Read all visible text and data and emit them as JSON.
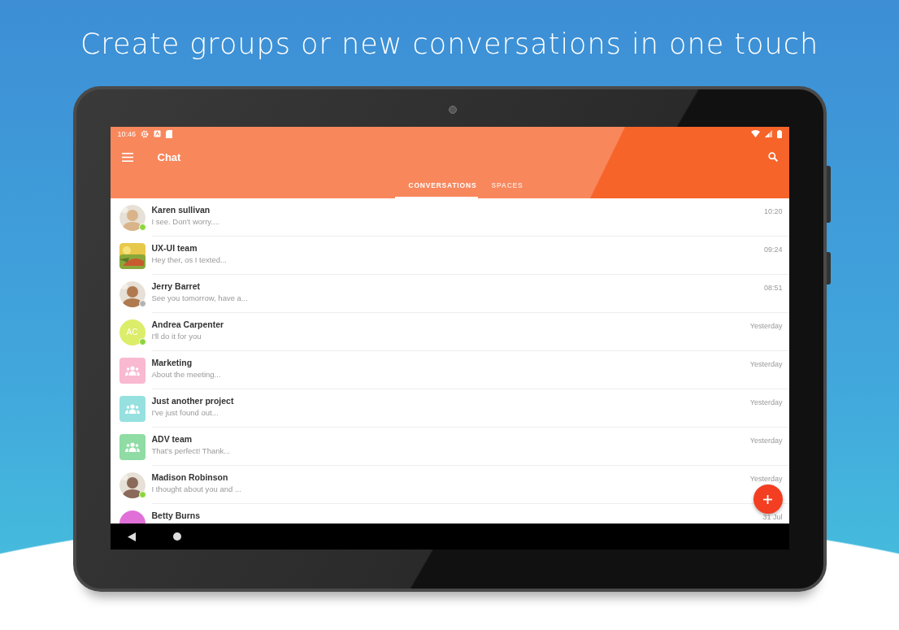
{
  "headline": "Create groups or new conversations in one touch",
  "status_bar": {
    "time": "10:46"
  },
  "toolbar": {
    "title": "Chat"
  },
  "tabs": [
    {
      "label": "CONVERSATIONS",
      "selected": true
    },
    {
      "label": "SPACES",
      "selected": false
    }
  ],
  "conversations": [
    {
      "name": "Karen sullivan",
      "preview": "I see. Don't worry....",
      "time": "10:20",
      "online": true
    },
    {
      "name": "UX-UI team",
      "preview": "Hey ther, os I texted...",
      "time": "09:24"
    },
    {
      "name": "Jerry Barret",
      "preview": "See you tomorrow, have a...",
      "time": "08:51",
      "online": false
    },
    {
      "name": "Andrea Carpenter",
      "preview": "I'll do it for you",
      "time": "Yesterday",
      "avatar": {
        "kind": "initials",
        "initials": "AC",
        "color": "#dced6a"
      },
      "online": true
    },
    {
      "name": "Marketing",
      "preview": "About the meeting...",
      "time": "Yesterday",
      "avatar": {
        "kind": "group",
        "color": "#f9b9d0"
      }
    },
    {
      "name": "Just another project",
      "preview": "I've just found out...",
      "time": "Yesterday",
      "avatar": {
        "kind": "group",
        "color": "#96e0e0"
      }
    },
    {
      "name": "ADV team",
      "preview": "That's perfect! Thank...",
      "time": "Yesterday",
      "avatar": {
        "kind": "group",
        "color": "#8fdca4"
      }
    },
    {
      "name": "Madison Robinson",
      "preview": "I thought about you and ...",
      "time": "Yesterday",
      "online": true
    },
    {
      "name": "Betty Burns",
      "time": "31 Jul",
      "avatar": {
        "kind": "initials",
        "color": "#e070d8"
      }
    }
  ]
}
